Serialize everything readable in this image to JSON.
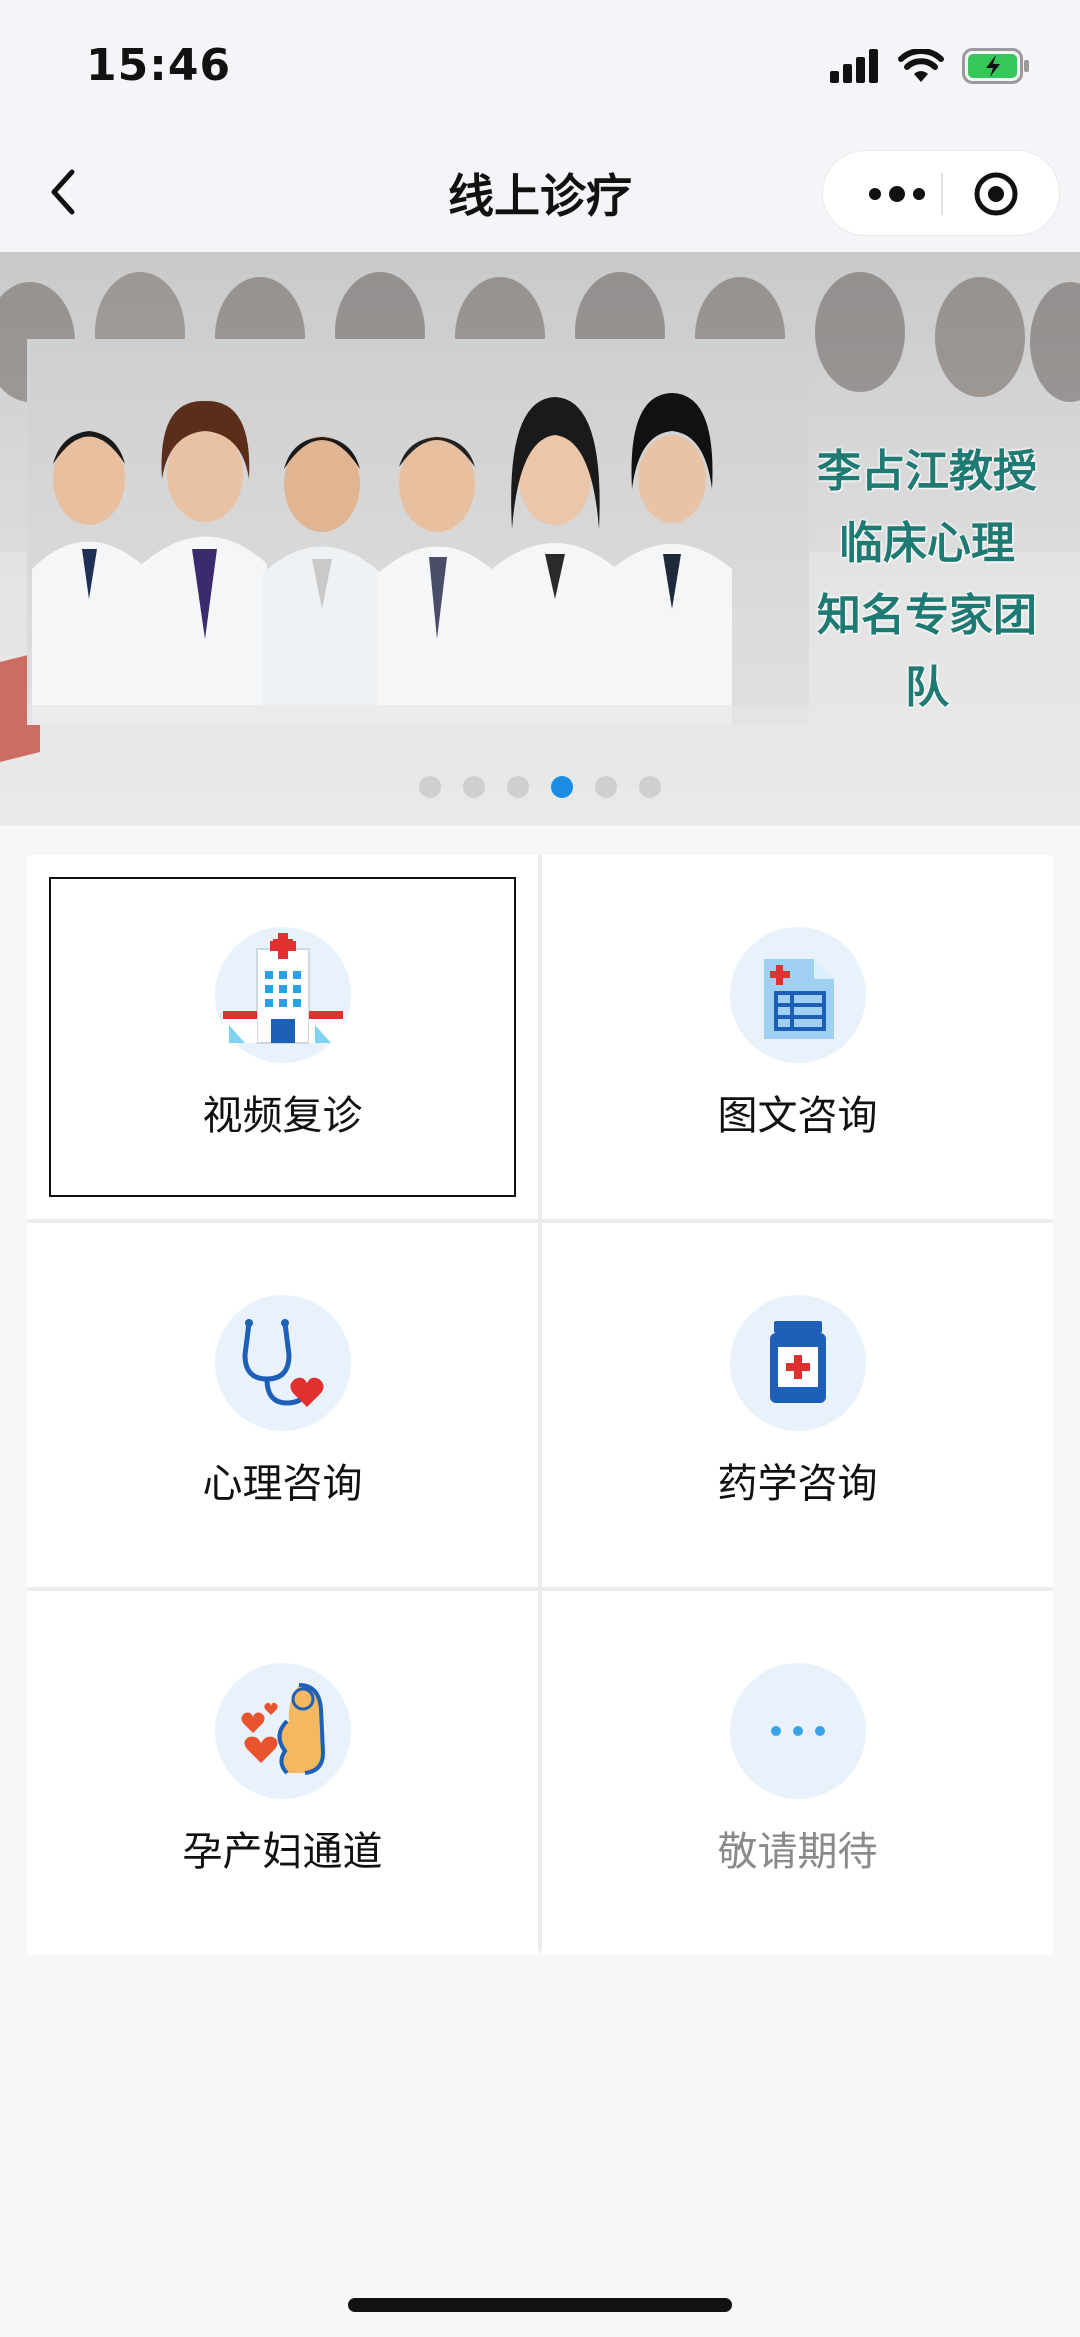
{
  "status": {
    "time": "15:46"
  },
  "nav": {
    "title": "线上诊疗"
  },
  "banner": {
    "text_lines": [
      "李占江教授",
      "临床心理",
      "知名专家团队"
    ],
    "slide_count": 6,
    "active_slide": 4,
    "accent": "#1a8ee6"
  },
  "services": [
    {
      "label": "视频复诊",
      "icon": "hospital-icon",
      "selected": true
    },
    {
      "label": "图文咨询",
      "icon": "medical-document-icon",
      "selected": false
    },
    {
      "label": "心理咨询",
      "icon": "stethoscope-icon",
      "selected": false
    },
    {
      "label": "药学咨询",
      "icon": "medicine-bottle-icon",
      "selected": false
    },
    {
      "label": "孕产妇通道",
      "icon": "pregnant-woman-icon",
      "selected": false
    },
    {
      "label": "敬请期待",
      "icon": "more-dots-icon",
      "selected": false,
      "disabled": true
    }
  ]
}
